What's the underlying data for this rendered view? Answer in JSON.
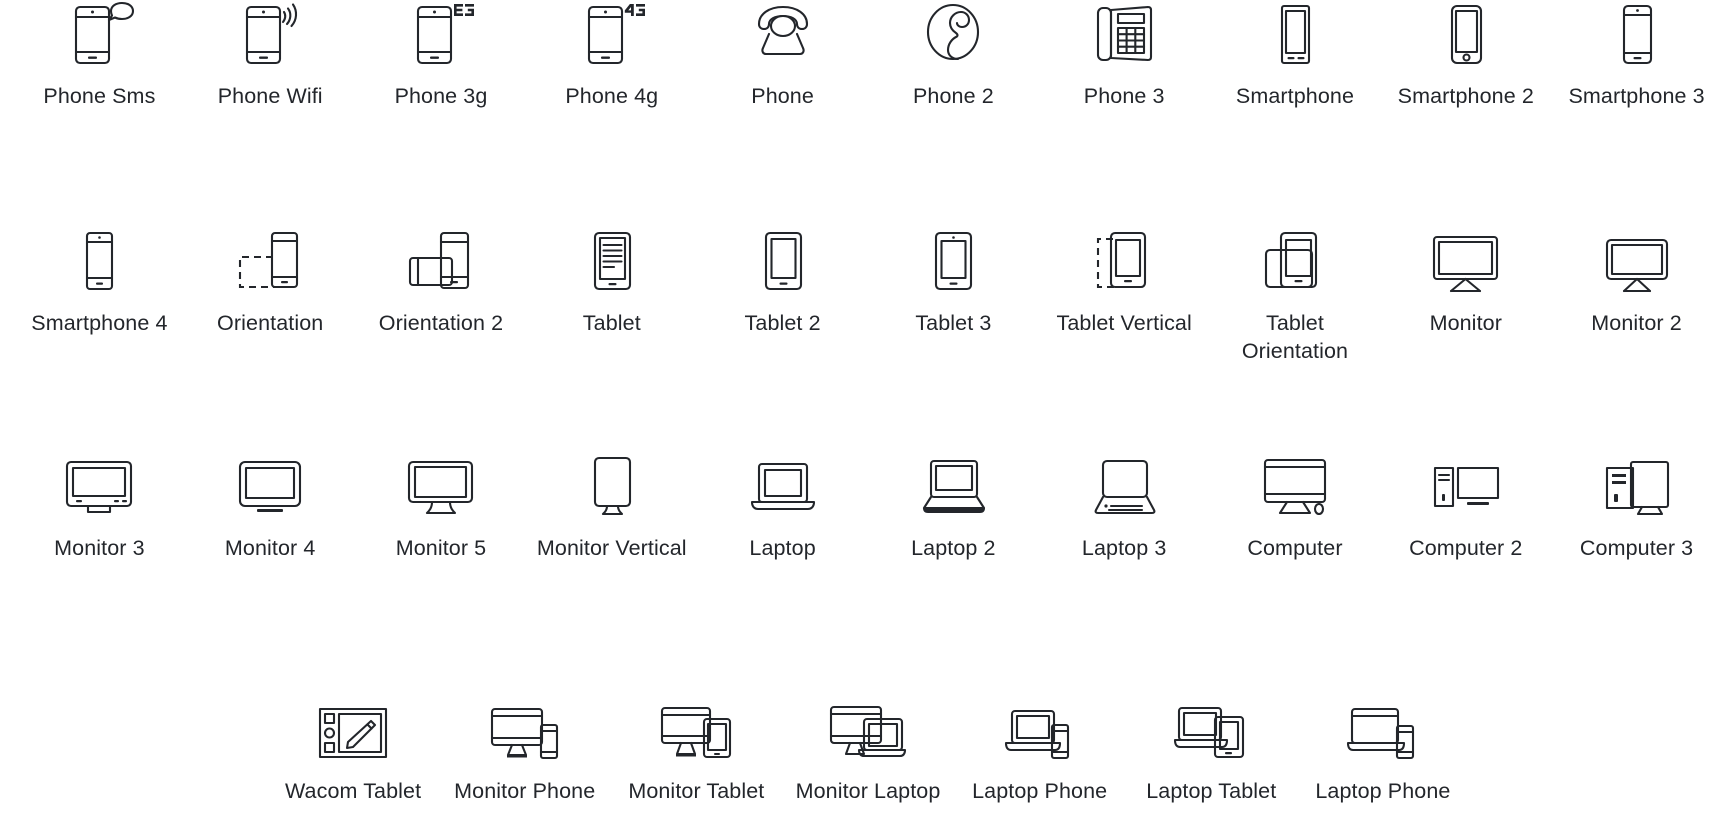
{
  "page": {
    "title": "Device Icon Set",
    "background_color": "#ffffff",
    "icon_stroke_color": "#23262b",
    "label_color": "#23262b",
    "columns_per_row": [
      10,
      10,
      10,
      7
    ],
    "total_icons": 37
  },
  "rows": [
    {
      "index": 1,
      "items": [
        {
          "label": "Phone Sms",
          "icon": "phone-sms-icon"
        },
        {
          "label": "Phone Wifi",
          "icon": "phone-wifi-icon"
        },
        {
          "label": "Phone 3g",
          "icon": "phone-3g-icon"
        },
        {
          "label": "Phone 4g",
          "icon": "phone-4g-icon"
        },
        {
          "label": "Phone",
          "icon": "phone-rotary-icon"
        },
        {
          "label": "Phone 2",
          "icon": "phone-handset-icon"
        },
        {
          "label": "Phone 3",
          "icon": "phone-desk-icon"
        },
        {
          "label": "Smartphone",
          "icon": "smartphone-icon"
        },
        {
          "label": "Smartphone 2",
          "icon": "smartphone-2-icon"
        },
        {
          "label": "Smartphone 3",
          "icon": "smartphone-3-icon"
        }
      ]
    },
    {
      "index": 2,
      "items": [
        {
          "label": "Smartphone 4",
          "icon": "smartphone-4-icon"
        },
        {
          "label": "Orientation",
          "icon": "orientation-icon"
        },
        {
          "label": "Orientation 2",
          "icon": "orientation-2-icon"
        },
        {
          "label": "Tablet",
          "icon": "tablet-icon"
        },
        {
          "label": "Tablet 2",
          "icon": "tablet-2-icon"
        },
        {
          "label": "Tablet 3",
          "icon": "tablet-3-icon"
        },
        {
          "label": "Tablet Vertical",
          "icon": "tablet-vertical-icon"
        },
        {
          "label": "Tablet Orientation",
          "icon": "tablet-orientation-icon"
        },
        {
          "label": "Monitor",
          "icon": "monitor-icon"
        },
        {
          "label": "Monitor 2",
          "icon": "monitor-2-icon"
        }
      ]
    },
    {
      "index": 3,
      "items": [
        {
          "label": "Monitor 3",
          "icon": "monitor-3-icon"
        },
        {
          "label": "Monitor 4",
          "icon": "monitor-4-icon"
        },
        {
          "label": "Monitor 5",
          "icon": "monitor-5-icon"
        },
        {
          "label": "Monitor Vertical",
          "icon": "monitor-vertical-icon"
        },
        {
          "label": "Laptop",
          "icon": "laptop-icon"
        },
        {
          "label": "Laptop 2",
          "icon": "laptop-2-icon"
        },
        {
          "label": "Laptop 3",
          "icon": "laptop-3-icon"
        },
        {
          "label": "Computer",
          "icon": "computer-icon"
        },
        {
          "label": "Computer 2",
          "icon": "computer-2-icon"
        },
        {
          "label": "Computer 3",
          "icon": "computer-3-icon"
        }
      ]
    },
    {
      "index": 4,
      "items": [
        {
          "label": "Wacom Tablet",
          "icon": "wacom-tablet-icon"
        },
        {
          "label": "Monitor Phone",
          "icon": "monitor-phone-icon"
        },
        {
          "label": "Monitor Tablet",
          "icon": "monitor-tablet-icon"
        },
        {
          "label": "Monitor Laptop",
          "icon": "monitor-laptop-icon"
        },
        {
          "label": "Laptop Phone",
          "icon": "laptop-phone-icon"
        },
        {
          "label": "Laptop Tablet",
          "icon": "laptop-tablet-icon"
        },
        {
          "label": "Laptop Phone",
          "icon": "laptop-phone-2-icon"
        }
      ]
    }
  ]
}
